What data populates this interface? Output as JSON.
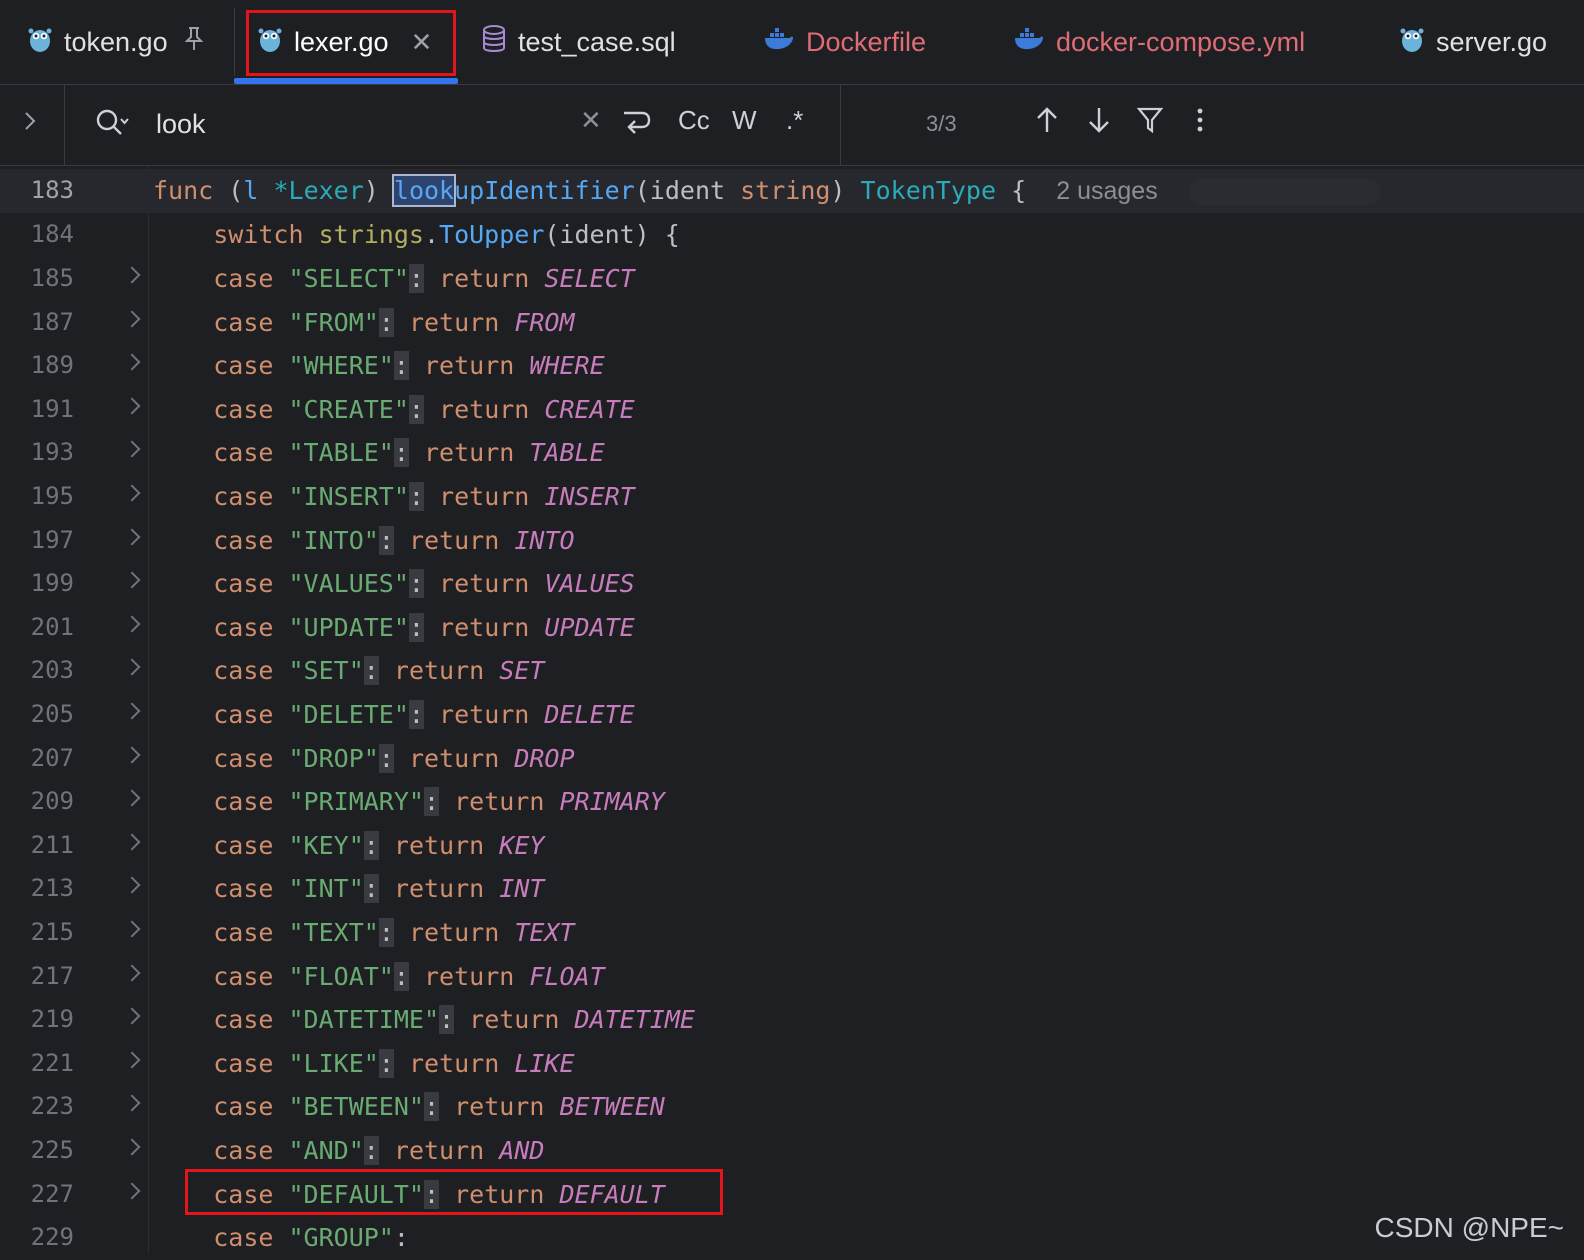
{
  "tabs": [
    {
      "label": "token.go",
      "icon": "gopher-icon",
      "pinned": true
    },
    {
      "label": "lexer.go",
      "icon": "gopher-icon",
      "active": true
    },
    {
      "label": "test_case.sql",
      "icon": "database-icon"
    },
    {
      "label": "Dockerfile",
      "icon": "docker-icon"
    },
    {
      "label": "docker-compose.yml",
      "icon": "docker-icon"
    },
    {
      "label": "server.go",
      "icon": "gopher-icon"
    }
  ],
  "search": {
    "query": "look",
    "match_count": "3/3",
    "match_case_label": "Cc",
    "words_label": "W",
    "regex_label": ".*"
  },
  "editor": {
    "header_line_number": "183",
    "header_code": {
      "func_kw": "func",
      "receiver_open": "(",
      "receiver_name": "l",
      "receiver_type": "*Lexer",
      "receiver_close": ")",
      "name_match": "look",
      "name_rest": "upIdentifier",
      "params_open": "(ident ",
      "param_type": "string",
      "params_close": ")",
      "return_type": "TokenType",
      "brace": "{",
      "usages": "2 usages"
    },
    "switch_line": {
      "number": "184",
      "kw": "switch",
      "pkg": "strings",
      "dot": ".",
      "func": "ToUpper",
      "rest": "(ident) {"
    },
    "cases": [
      {
        "number": "185",
        "label": "\"SELECT\"",
        "value": "SELECT"
      },
      {
        "number": "187",
        "label": "\"FROM\"",
        "value": "FROM"
      },
      {
        "number": "189",
        "label": "\"WHERE\"",
        "value": "WHERE"
      },
      {
        "number": "191",
        "label": "\"CREATE\"",
        "value": "CREATE"
      },
      {
        "number": "193",
        "label": "\"TABLE\"",
        "value": "TABLE"
      },
      {
        "number": "195",
        "label": "\"INSERT\"",
        "value": "INSERT"
      },
      {
        "number": "197",
        "label": "\"INTO\"",
        "value": "INTO"
      },
      {
        "number": "199",
        "label": "\"VALUES\"",
        "value": "VALUES"
      },
      {
        "number": "201",
        "label": "\"UPDATE\"",
        "value": "UPDATE"
      },
      {
        "number": "203",
        "label": "\"SET\"",
        "value": "SET"
      },
      {
        "number": "205",
        "label": "\"DELETE\"",
        "value": "DELETE"
      },
      {
        "number": "207",
        "label": "\"DROP\"",
        "value": "DROP"
      },
      {
        "number": "209",
        "label": "\"PRIMARY\"",
        "value": "PRIMARY"
      },
      {
        "number": "211",
        "label": "\"KEY\"",
        "value": "KEY"
      },
      {
        "number": "213",
        "label": "\"INT\"",
        "value": "INT"
      },
      {
        "number": "215",
        "label": "\"TEXT\"",
        "value": "TEXT"
      },
      {
        "number": "217",
        "label": "\"FLOAT\"",
        "value": "FLOAT"
      },
      {
        "number": "219",
        "label": "\"DATETIME\"",
        "value": "DATETIME"
      },
      {
        "number": "221",
        "label": "\"LIKE\"",
        "value": "LIKE"
      },
      {
        "number": "223",
        "label": "\"BETWEEN\"",
        "value": "BETWEEN"
      },
      {
        "number": "225",
        "label": "\"AND\"",
        "value": "AND"
      },
      {
        "number": "227",
        "label": "\"DEFAULT\"",
        "value": "DEFAULT"
      }
    ],
    "partial_line": {
      "number": "229",
      "label": "\"GROUP\""
    },
    "case_kw": "case",
    "return_kw": "return",
    "colon": ":"
  },
  "watermark": "CSDN @NPE~",
  "colors": {
    "highlight_box": "#e3151a",
    "active_tab_underline": "#3574f0",
    "keyword": "#cf8e6d",
    "string": "#6aab73",
    "constant": "#c77dbb",
    "function": "#56a8f5"
  }
}
